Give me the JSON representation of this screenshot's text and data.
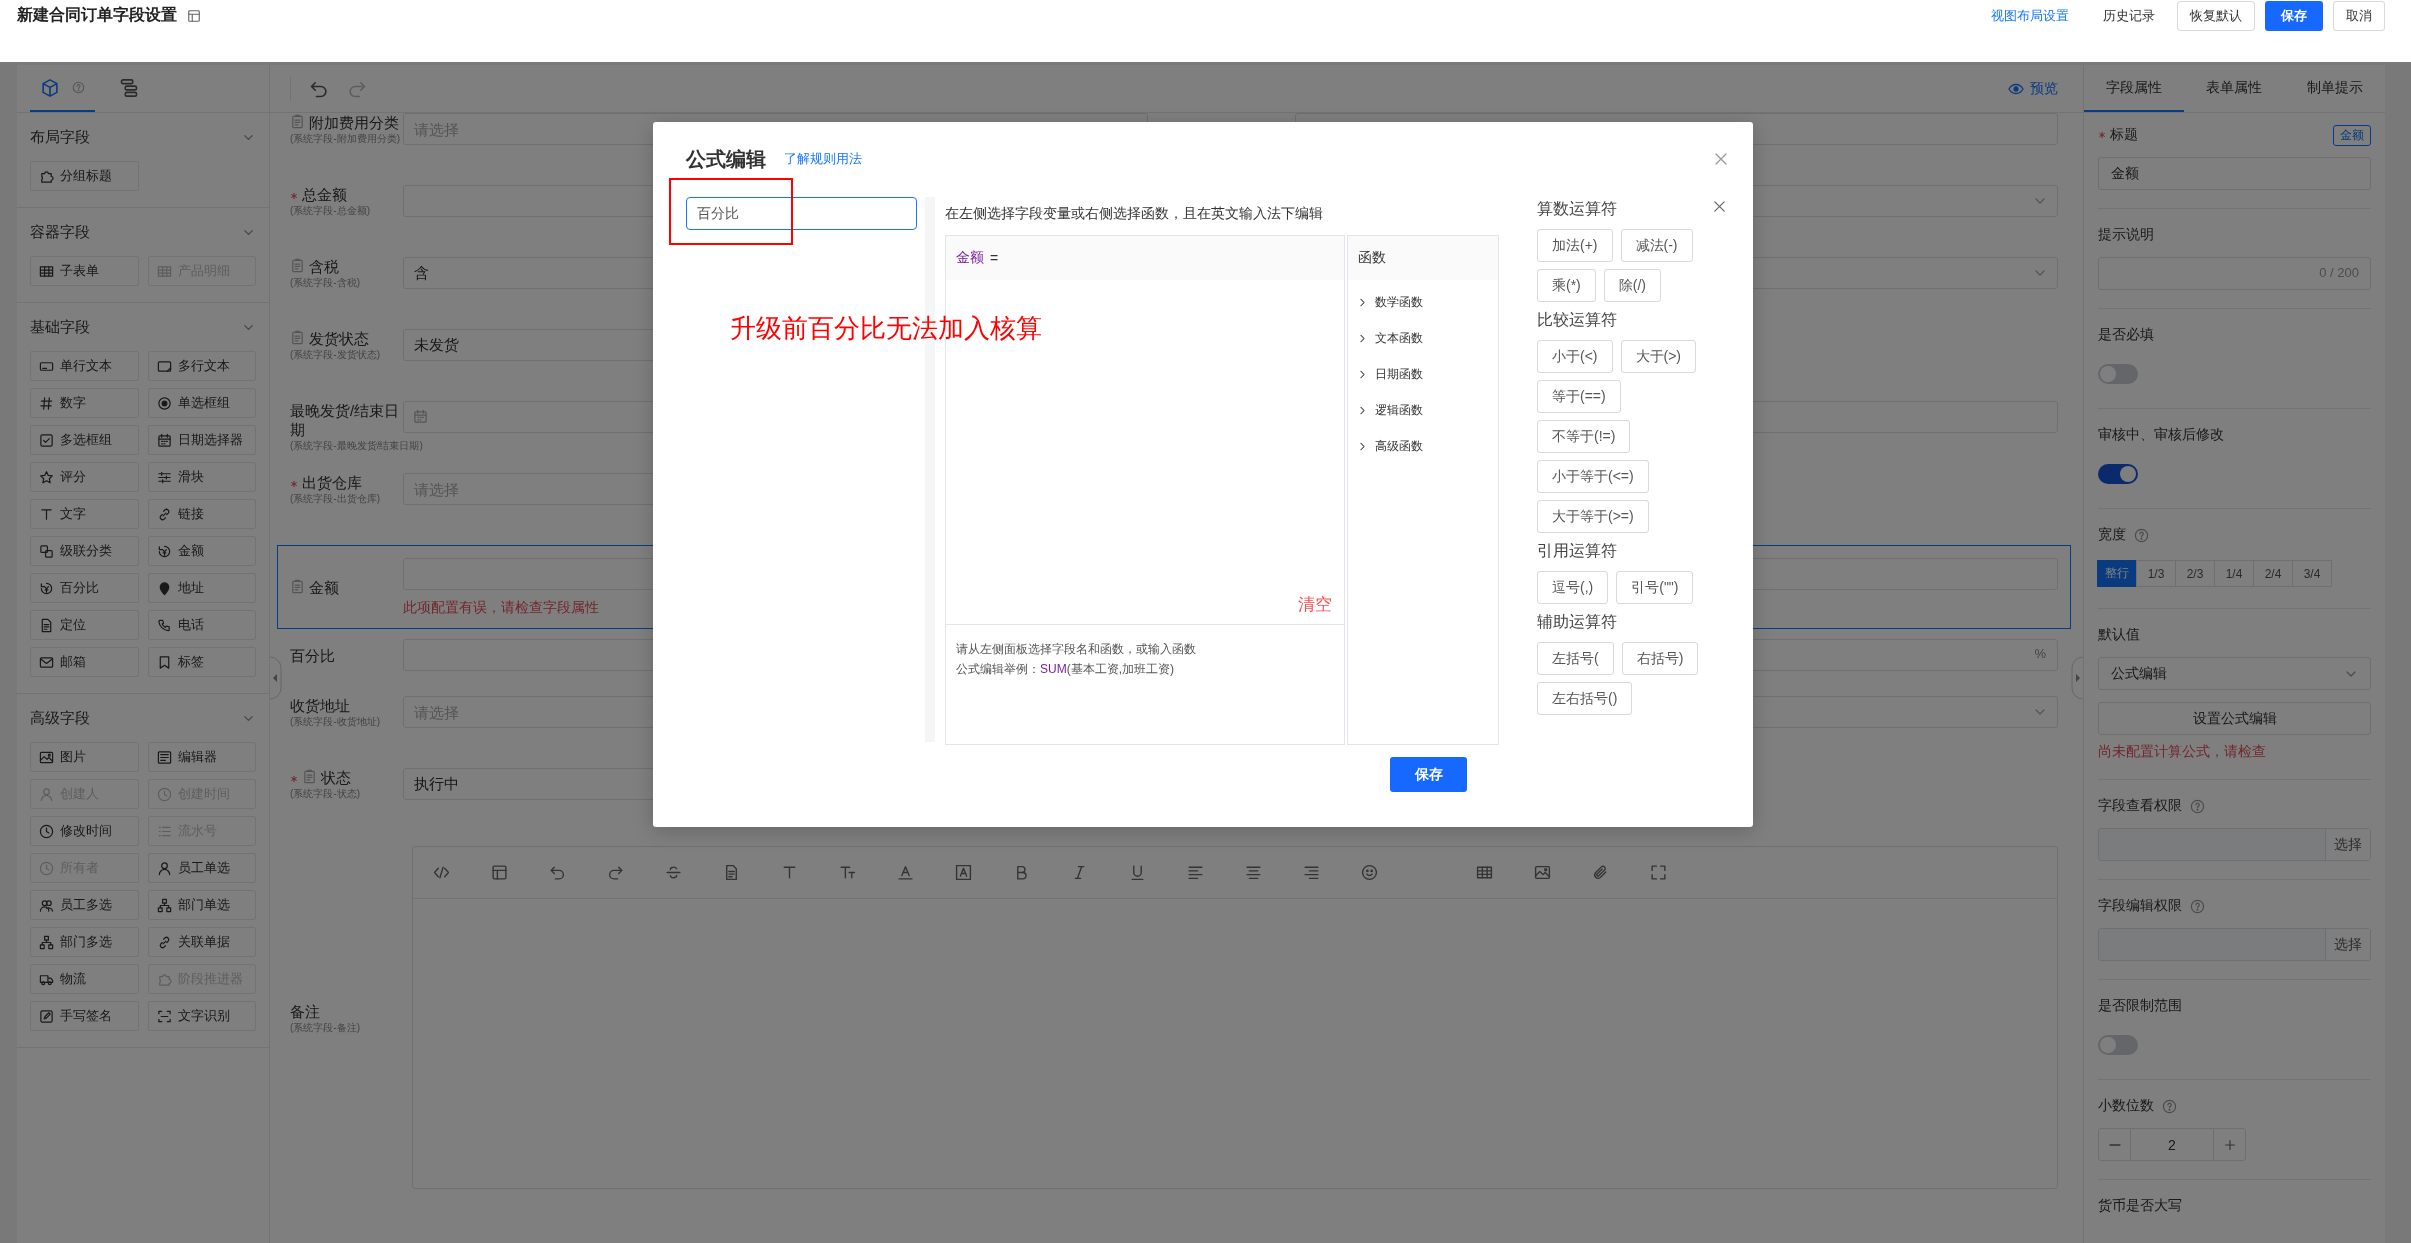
{
  "header": {
    "title": "新建合同订单字段设置",
    "actions": [
      {
        "label": "视图布局设置",
        "kind": "link"
      },
      {
        "label": "历史记录",
        "kind": "text"
      },
      {
        "label": "恢复默认",
        "kind": "default"
      },
      {
        "label": "保存",
        "kind": "primary"
      },
      {
        "label": "取消",
        "kind": "default"
      }
    ]
  },
  "palette": {
    "tabs": [
      {
        "selected": true
      },
      {
        "selected": false
      }
    ],
    "groups": [
      {
        "title": "布局字段",
        "expanded": true,
        "items": [
          {
            "label": "分组标题",
            "disabled": false
          }
        ]
      },
      {
        "title": "容器字段",
        "expanded": true,
        "items": [
          {
            "label": "子表单",
            "disabled": false
          },
          {
            "label": "产品明细",
            "disabled": true
          }
        ]
      },
      {
        "title": "基础字段",
        "expanded": true,
        "items": [
          {
            "label": "单行文本",
            "disabled": false
          },
          {
            "label": "多行文本",
            "disabled": false
          },
          {
            "label": "数字",
            "disabled": false
          },
          {
            "label": "单选框组",
            "disabled": false
          },
          {
            "label": "多选框组",
            "disabled": false
          },
          {
            "label": "日期选择器",
            "disabled": false
          },
          {
            "label": "评分",
            "disabled": false
          },
          {
            "label": "滑块",
            "disabled": false
          },
          {
            "label": "文字",
            "disabled": false
          },
          {
            "label": "链接",
            "disabled": false
          },
          {
            "label": "级联分类",
            "disabled": false
          },
          {
            "label": "金额",
            "disabled": false
          },
          {
            "label": "百分比",
            "disabled": false
          },
          {
            "label": "地址",
            "disabled": false
          },
          {
            "label": "定位",
            "disabled": false
          },
          {
            "label": "电话",
            "disabled": false
          },
          {
            "label": "邮箱",
            "disabled": false
          },
          {
            "label": "标签",
            "disabled": false
          }
        ]
      },
      {
        "title": "高级字段",
        "expanded": true,
        "items": [
          {
            "label": "图片",
            "disabled": false
          },
          {
            "label": "编辑器",
            "disabled": false
          },
          {
            "label": "创建人",
            "disabled": true
          },
          {
            "label": "创建时间",
            "disabled": true
          },
          {
            "label": "修改时间",
            "disabled": false
          },
          {
            "label": "流水号",
            "disabled": true
          },
          {
            "label": "所有者",
            "disabled": true
          },
          {
            "label": "员工单选",
            "disabled": false
          },
          {
            "label": "员工多选",
            "disabled": false
          },
          {
            "label": "部门单选",
            "disabled": false
          },
          {
            "label": "部门多选",
            "disabled": false
          },
          {
            "label": "关联单据",
            "disabled": false
          },
          {
            "label": "物流",
            "disabled": false
          },
          {
            "label": "阶段推进器",
            "disabled": true
          },
          {
            "label": "手写签名",
            "disabled": false
          },
          {
            "label": "文字识别",
            "disabled": false
          }
        ]
      }
    ]
  },
  "canvas": {
    "preview": "预览",
    "rows": [
      {
        "kind": "pair",
        "selected": false,
        "left": {
          "label": "附加费用分类",
          "note": "(系统字段-附加费用分类)",
          "required": false,
          "flagged": true,
          "kind": "text",
          "placeholder": "请选择"
        },
        "right": {
          "kind": "text"
        }
      },
      {
        "kind": "pair",
        "selected": false,
        "left": {
          "label": "总金额",
          "note": "(系统字段-总金额)",
          "required": true,
          "flagged": false,
          "kind": "text"
        },
        "right": {
          "kind": "select"
        }
      },
      {
        "kind": "pair",
        "selected": false,
        "left": {
          "label": "含税",
          "note": "(系统字段-含税)",
          "required": false,
          "flagged": true,
          "kind": "text",
          "value": "含"
        },
        "right": {
          "kind": "select"
        }
      },
      {
        "kind": "pair",
        "selected": false,
        "left": {
          "label": "发货状态",
          "note": "(系统字段-发货状态)",
          "required": false,
          "flagged": true,
          "kind": "text",
          "value": "未发货"
        }
      },
      {
        "kind": "pair",
        "selected": false,
        "left": {
          "label": "最晚发货/结束日期",
          "note": "(系统字段-最晚发货/结束日期)",
          "required": false,
          "flagged": false,
          "kind": "date"
        },
        "right": {
          "kind": "text"
        }
      },
      {
        "kind": "pair",
        "selected": false,
        "left": {
          "label": "出货仓库",
          "note": "(系统字段-出货仓库)",
          "required": true,
          "flagged": false,
          "kind": "text",
          "placeholder": "请选择"
        }
      },
      {
        "kind": "wide",
        "selected": true,
        "label": "金额",
        "required": false,
        "flagged": true,
        "error": "此项配置有误，请检查字段属性"
      },
      {
        "kind": "wide",
        "selected": false,
        "label": "百分比",
        "required": false,
        "flagged": false,
        "suffix": "%"
      },
      {
        "kind": "pair",
        "selected": false,
        "left": {
          "label": "收货地址",
          "note": "(系统字段-收货地址)",
          "required": false,
          "flagged": false,
          "kind": "text",
          "placeholder": "请选择"
        },
        "right": {
          "kind": "select"
        }
      },
      {
        "kind": "pair",
        "selected": false,
        "left": {
          "label": "状态",
          "note": "(系统字段-状态)",
          "required": true,
          "flagged": true,
          "kind": "text",
          "value": "执行中"
        }
      },
      {
        "kind": "editor",
        "selected": false,
        "label": "备注",
        "note": "(系统字段-备注)",
        "required": false,
        "flagged": false
      }
    ]
  },
  "properties": {
    "tabs": [
      {
        "label": "字段属性",
        "selected": true
      },
      {
        "label": "表单属性",
        "selected": false
      },
      {
        "label": "制单提示",
        "selected": false
      }
    ],
    "items": [
      {
        "kind": "text",
        "label": "标题",
        "required": true,
        "help": false,
        "tag": "金额",
        "value": "金额"
      },
      {
        "kind": "textarea",
        "label": "提示说明",
        "required": false,
        "help": false,
        "counter": "0 / 200"
      },
      {
        "kind": "switch",
        "label": "是否必填",
        "required": false,
        "help": false,
        "on": false
      },
      {
        "kind": "switch",
        "label": "审核中、审核后修改",
        "required": false,
        "help": false,
        "on": true
      },
      {
        "kind": "segments",
        "label": "宽度",
        "required": false,
        "help": true,
        "options": [
          {
            "label": "整行",
            "selected": true
          },
          {
            "label": "1/3",
            "selected": false
          },
          {
            "label": "2/3",
            "selected": false
          },
          {
            "label": "1/4",
            "selected": false
          },
          {
            "label": "2/4",
            "selected": false
          },
          {
            "label": "3/4",
            "selected": false
          }
        ]
      },
      {
        "kind": "formula",
        "label": "默认值",
        "required": false,
        "help": false,
        "value": "公式编辑",
        "button": "设置公式编辑",
        "error": "尚未配置计算公式，请检查"
      },
      {
        "kind": "picker",
        "label": "字段查看权限",
        "required": false,
        "help": true,
        "action": "选择"
      },
      {
        "kind": "picker",
        "label": "字段编辑权限",
        "required": false,
        "help": true,
        "action": "选择"
      },
      {
        "kind": "switch",
        "label": "是否限制范围",
        "required": false,
        "help": false,
        "on": false
      },
      {
        "kind": "stepper",
        "label": "小数位数",
        "required": false,
        "help": true,
        "value": "2"
      },
      {
        "kind": "heading",
        "label": "货币是否大写",
        "required": false,
        "help": false
      }
    ]
  },
  "dialog": {
    "title": "公式编辑",
    "help_link": "了解规则用法",
    "search": {
      "value": "百分比"
    },
    "annotation": "升级前百分比无法加入核算",
    "instruction": "在左侧选择字段变量或右侧选择函数，且在英文输入法下编辑",
    "formula": {
      "field": "金额",
      "operator": "="
    },
    "clear": "清空",
    "hint": {
      "line": "请从左侧面板选择字段名和函数，或输入函数",
      "example_label": "公式编辑举例：",
      "example_function": "SUM",
      "example_args": "(基本工资,加班工资)"
    },
    "functions": {
      "title": "函数",
      "items": [
        {
          "label": "数学函数",
          "expanded": false
        },
        {
          "label": "文本函数",
          "expanded": false
        },
        {
          "label": "日期函数",
          "expanded": false
        },
        {
          "label": "逻辑函数",
          "expanded": false
        },
        {
          "label": "高级函数",
          "expanded": false
        }
      ]
    },
    "operators": [
      {
        "title": "算数运算符",
        "rows": [
          [
            "加法(+)",
            "减法(-)"
          ],
          [
            "乘(*)",
            "除(/)"
          ]
        ]
      },
      {
        "title": "比较运算符",
        "rows": [
          [
            "小于(<)",
            "大于(>)"
          ],
          [
            "等于(==)"
          ],
          [
            "不等于(!=)"
          ],
          [
            "小于等于(<=)"
          ],
          [
            "大于等于(>=)"
          ]
        ]
      },
      {
        "title": "引用运算符",
        "rows": [
          [
            "逗号(,)",
            "引号(\"\")"
          ]
        ]
      },
      {
        "title": "辅助运算符",
        "rows": [
          [
            "左括号(",
            "右括号)"
          ],
          [
            "左右括号()"
          ]
        ]
      }
    ],
    "save": "保存"
  }
}
